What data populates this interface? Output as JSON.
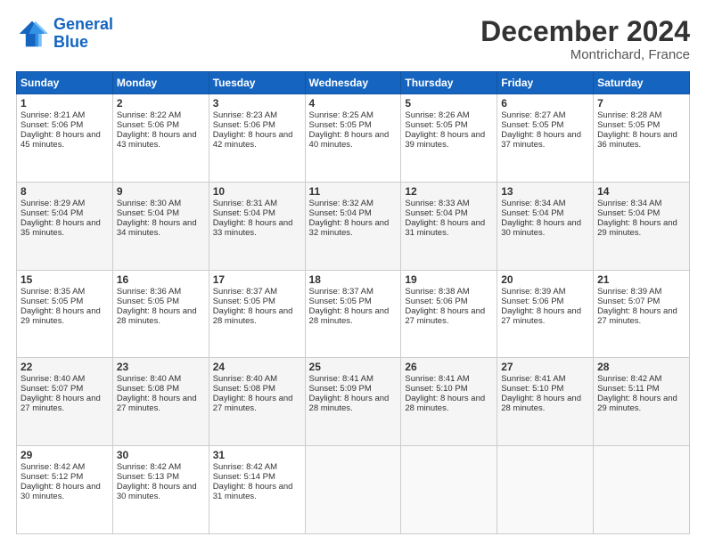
{
  "logo": {
    "line1": "General",
    "line2": "Blue"
  },
  "title": "December 2024",
  "subtitle": "Montrichard, France",
  "header": {
    "days": [
      "Sunday",
      "Monday",
      "Tuesday",
      "Wednesday",
      "Thursday",
      "Friday",
      "Saturday"
    ]
  },
  "weeks": [
    [
      {
        "day": 1,
        "sunrise": "8:21 AM",
        "sunset": "5:06 PM",
        "daylight": "8 hours and 45 minutes."
      },
      {
        "day": 2,
        "sunrise": "8:22 AM",
        "sunset": "5:06 PM",
        "daylight": "8 hours and 43 minutes."
      },
      {
        "day": 3,
        "sunrise": "8:23 AM",
        "sunset": "5:06 PM",
        "daylight": "8 hours and 42 minutes."
      },
      {
        "day": 4,
        "sunrise": "8:25 AM",
        "sunset": "5:05 PM",
        "daylight": "8 hours and 40 minutes."
      },
      {
        "day": 5,
        "sunrise": "8:26 AM",
        "sunset": "5:05 PM",
        "daylight": "8 hours and 39 minutes."
      },
      {
        "day": 6,
        "sunrise": "8:27 AM",
        "sunset": "5:05 PM",
        "daylight": "8 hours and 37 minutes."
      },
      {
        "day": 7,
        "sunrise": "8:28 AM",
        "sunset": "5:05 PM",
        "daylight": "8 hours and 36 minutes."
      }
    ],
    [
      {
        "day": 8,
        "sunrise": "8:29 AM",
        "sunset": "5:04 PM",
        "daylight": "8 hours and 35 minutes."
      },
      {
        "day": 9,
        "sunrise": "8:30 AM",
        "sunset": "5:04 PM",
        "daylight": "8 hours and 34 minutes."
      },
      {
        "day": 10,
        "sunrise": "8:31 AM",
        "sunset": "5:04 PM",
        "daylight": "8 hours and 33 minutes."
      },
      {
        "day": 11,
        "sunrise": "8:32 AM",
        "sunset": "5:04 PM",
        "daylight": "8 hours and 32 minutes."
      },
      {
        "day": 12,
        "sunrise": "8:33 AM",
        "sunset": "5:04 PM",
        "daylight": "8 hours and 31 minutes."
      },
      {
        "day": 13,
        "sunrise": "8:34 AM",
        "sunset": "5:04 PM",
        "daylight": "8 hours and 30 minutes."
      },
      {
        "day": 14,
        "sunrise": "8:34 AM",
        "sunset": "5:04 PM",
        "daylight": "8 hours and 29 minutes."
      }
    ],
    [
      {
        "day": 15,
        "sunrise": "8:35 AM",
        "sunset": "5:05 PM",
        "daylight": "8 hours and 29 minutes."
      },
      {
        "day": 16,
        "sunrise": "8:36 AM",
        "sunset": "5:05 PM",
        "daylight": "8 hours and 28 minutes."
      },
      {
        "day": 17,
        "sunrise": "8:37 AM",
        "sunset": "5:05 PM",
        "daylight": "8 hours and 28 minutes."
      },
      {
        "day": 18,
        "sunrise": "8:37 AM",
        "sunset": "5:05 PM",
        "daylight": "8 hours and 28 minutes."
      },
      {
        "day": 19,
        "sunrise": "8:38 AM",
        "sunset": "5:06 PM",
        "daylight": "8 hours and 27 minutes."
      },
      {
        "day": 20,
        "sunrise": "8:39 AM",
        "sunset": "5:06 PM",
        "daylight": "8 hours and 27 minutes."
      },
      {
        "day": 21,
        "sunrise": "8:39 AM",
        "sunset": "5:07 PM",
        "daylight": "8 hours and 27 minutes."
      }
    ],
    [
      {
        "day": 22,
        "sunrise": "8:40 AM",
        "sunset": "5:07 PM",
        "daylight": "8 hours and 27 minutes."
      },
      {
        "day": 23,
        "sunrise": "8:40 AM",
        "sunset": "5:08 PM",
        "daylight": "8 hours and 27 minutes."
      },
      {
        "day": 24,
        "sunrise": "8:40 AM",
        "sunset": "5:08 PM",
        "daylight": "8 hours and 27 minutes."
      },
      {
        "day": 25,
        "sunrise": "8:41 AM",
        "sunset": "5:09 PM",
        "daylight": "8 hours and 28 minutes."
      },
      {
        "day": 26,
        "sunrise": "8:41 AM",
        "sunset": "5:10 PM",
        "daylight": "8 hours and 28 minutes."
      },
      {
        "day": 27,
        "sunrise": "8:41 AM",
        "sunset": "5:10 PM",
        "daylight": "8 hours and 28 minutes."
      },
      {
        "day": 28,
        "sunrise": "8:42 AM",
        "sunset": "5:11 PM",
        "daylight": "8 hours and 29 minutes."
      }
    ],
    [
      {
        "day": 29,
        "sunrise": "8:42 AM",
        "sunset": "5:12 PM",
        "daylight": "8 hours and 30 minutes."
      },
      {
        "day": 30,
        "sunrise": "8:42 AM",
        "sunset": "5:13 PM",
        "daylight": "8 hours and 30 minutes."
      },
      {
        "day": 31,
        "sunrise": "8:42 AM",
        "sunset": "5:14 PM",
        "daylight": "8 hours and 31 minutes."
      },
      null,
      null,
      null,
      null
    ]
  ]
}
